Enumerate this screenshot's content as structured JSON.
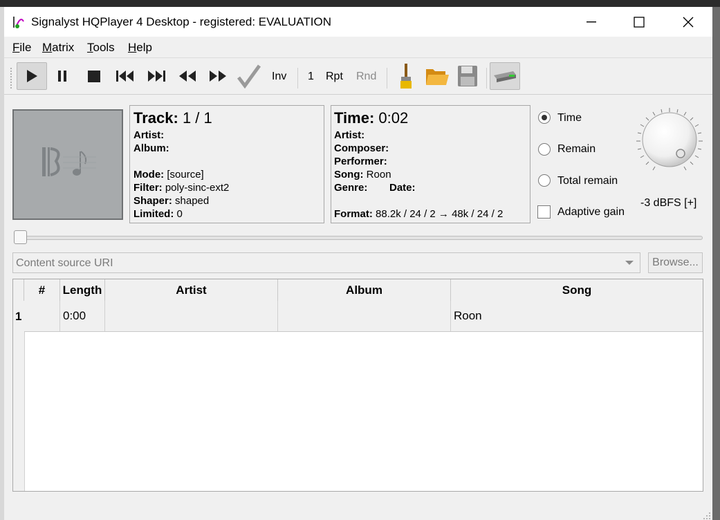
{
  "window": {
    "title": "Signalyst HQPlayer 4 Desktop - registered: EVALUATION",
    "controls": {
      "minimize": "—",
      "maximize": "☐",
      "close": "✕"
    }
  },
  "menu": [
    "File",
    "Matrix",
    "Tools",
    "Help"
  ],
  "menu_mnemonics": [
    "F",
    "M",
    "T",
    "H"
  ],
  "toolbar": {
    "inv_label": "Inv",
    "repeat_count": "1",
    "rpt_label": "Rpt",
    "rnd_label": "Rnd",
    "icons": [
      "play-icon",
      "pause-icon",
      "stop-icon",
      "previous-track-icon",
      "next-track-icon",
      "rewind-icon",
      "fast-forward-icon",
      "check-icon",
      "brush-icon",
      "open-folder-icon",
      "save-icon",
      "audio-device-icon"
    ]
  },
  "track_info": {
    "track_label": "Track:",
    "track_value": "1 / 1",
    "artist_label": "Artist:",
    "artist_value": "",
    "album_label": "Album:",
    "album_value": "",
    "mode_label": "Mode:",
    "mode_value": "[source]",
    "filter_label": "Filter:",
    "filter_value": "poly-sinc-ext2",
    "shaper_label": "Shaper:",
    "shaper_value": "shaped",
    "limited_label": "Limited:",
    "limited_value": "0"
  },
  "time_info": {
    "time_label": "Time:",
    "time_value": "0:02",
    "artist_label": "Artist:",
    "composer_label": "Composer:",
    "performer_label": "Performer:",
    "song_label": "Song:",
    "song_value": "Roon",
    "genre_label": "Genre:",
    "date_label": "Date:",
    "format_label": "Format:",
    "format_value": "88.2k / 24 / 2 → 48k / 24 / 2"
  },
  "display_mode": {
    "options": [
      "Time",
      "Remain",
      "Total remain"
    ],
    "selected": "Time",
    "adaptive_gain_label": "Adaptive gain",
    "adaptive_gain_checked": false
  },
  "volume": {
    "level_text": "-3 dBFS [+]"
  },
  "seek": {
    "position_fraction": 0.0
  },
  "source": {
    "placeholder": "Content source URI",
    "browse_label": "Browse..."
  },
  "playlist": {
    "columns": [
      "#",
      "Length",
      "Artist",
      "Album",
      "Song"
    ],
    "rows": [
      {
        "row_number": "1",
        "num": "",
        "length": "0:00",
        "artist": "",
        "album": "",
        "song": "Roon"
      }
    ]
  }
}
